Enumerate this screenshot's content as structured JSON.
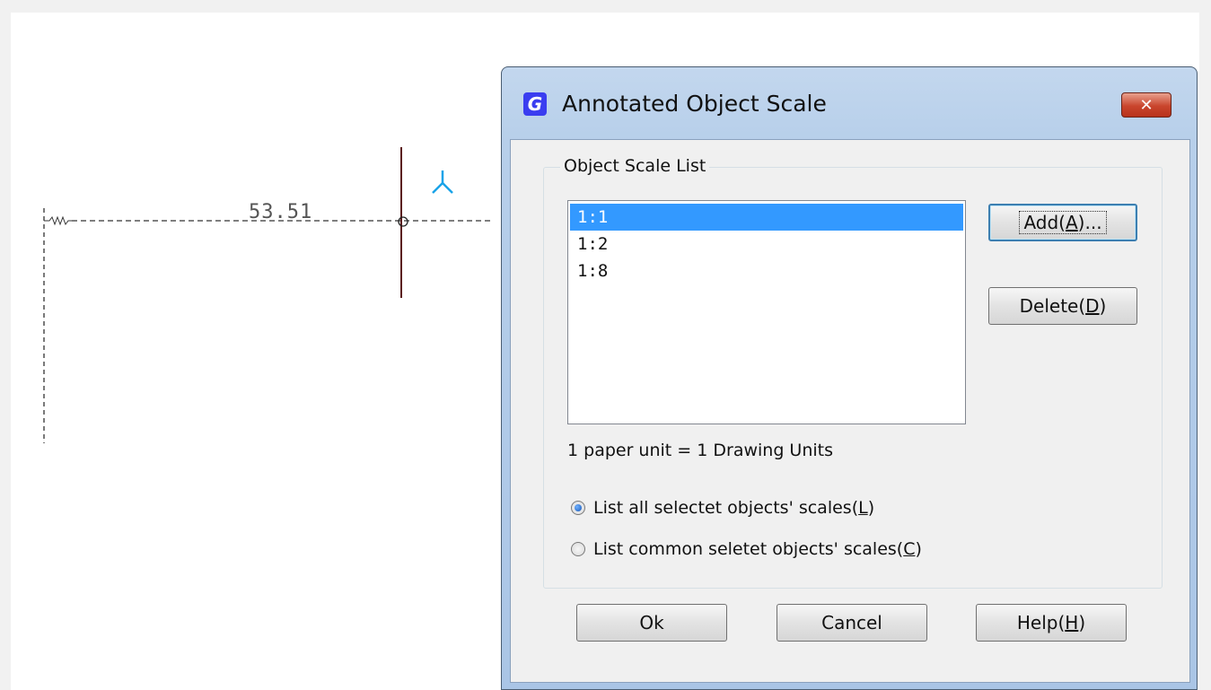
{
  "drawing": {
    "dimension_value": "53.51"
  },
  "dialog": {
    "title": "Annotated Object Scale",
    "close_label": "✕",
    "group_label": "Object Scale List",
    "scales": [
      "1:1",
      "1:2",
      "1:8"
    ],
    "selected_scale": "1:1",
    "add_button": {
      "text": "Add(",
      "key": "A",
      "suffix": ")..."
    },
    "delete_button": {
      "text": "Delete(",
      "key": "D",
      "suffix": ")"
    },
    "unit_info": "1  paper unit = 1  Drawing Units",
    "radio_all": {
      "text": "List all selectet objects' scales(",
      "key": "L",
      "suffix": ")",
      "checked": true
    },
    "radio_common": {
      "text": "List common seletet objects' scales(",
      "key": "C",
      "suffix": ")",
      "checked": false
    },
    "ok_label": "Ok",
    "cancel_label": "Cancel",
    "help_button": {
      "text": "Help(",
      "key": "H",
      "suffix": ")"
    }
  },
  "colors": {
    "selection": "#3399ff",
    "close_button": "#c9452d",
    "title_icon": "#3a3df0",
    "ucs_icon": "#1aa3e8",
    "crosshair": "#5a1a1a"
  },
  "icons": {
    "app": "gstarcad-g-icon",
    "close": "close-icon",
    "ucs": "ucs-axis-icon"
  }
}
